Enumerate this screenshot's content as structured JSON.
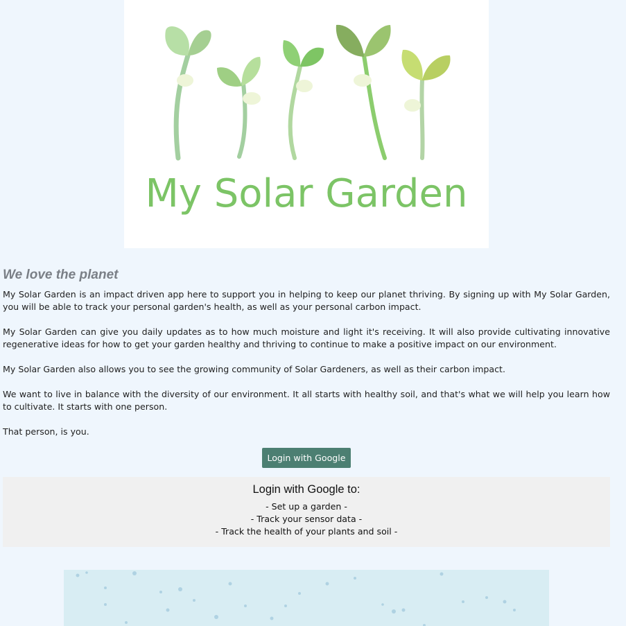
{
  "hero": {
    "logo_text": "My Solar Garden"
  },
  "about": {
    "heading": "We love the planet",
    "paragraphs": [
      "My Solar Garden is an impact driven app here to support you in helping to keep our planet thriving. By signing up with My Solar Garden, you will be able to track your personal garden's health, as well as your personal carbon impact.",
      "My Solar Garden can give you daily updates as to how much moisture and light it's receiving. It will also provide cultivating innovative regenerative ideas for how to get your garden healthy and thriving to continue to make a positive impact on our environment.",
      "My Solar Garden also allows you to see the growing community of Solar Gardeners, as well as their carbon impact.",
      "We want to live in balance with the diversity of our environment. It all starts with healthy soil, and that's what we will help you learn how to cultivate. It starts with one person.",
      "That person, is you."
    ]
  },
  "login": {
    "button_label": "Login with Google"
  },
  "info": {
    "title": "Login with Google to:",
    "items": [
      "- Set up a garden -",
      "- Track your sensor data -",
      "- Track the health of your plants and soil -"
    ]
  },
  "colors": {
    "page_background": "#eff6fd",
    "button": "#4c7f72",
    "logo_green": "#7cc466",
    "info_box": "#f0f0f0"
  }
}
